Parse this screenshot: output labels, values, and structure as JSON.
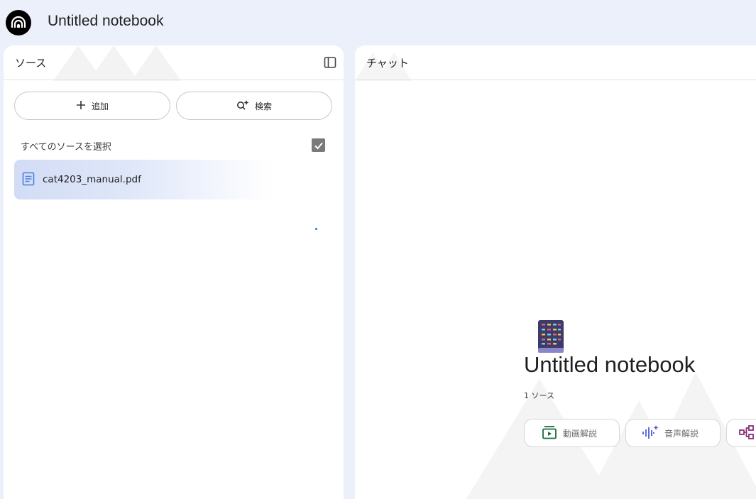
{
  "app": {
    "title": "Untitled notebook",
    "logo_icon": "notebooklm-logo-icon"
  },
  "sources_panel": {
    "title": "ソース",
    "collapse_icon": "panel-collapse-icon",
    "add_button": {
      "label": "追加",
      "icon": "plus-icon"
    },
    "search_button": {
      "label": "検索",
      "icon": "search-sparkle-icon"
    },
    "select_all_label": "すべてのソースを選択",
    "select_all_checked": true,
    "items": [
      {
        "name": "cat4203_manual.pdf",
        "icon": "document-icon",
        "loading": true
      }
    ]
  },
  "chat_panel": {
    "title": "チャット",
    "notebook": {
      "emoji_icon": "notebook-emoji-icon",
      "title": "Untitled notebook",
      "source_count": "1 ソース"
    },
    "studio_buttons": [
      {
        "label": "動画解説",
        "icon": "video-overview-icon",
        "color": "#1e6b3a"
      },
      {
        "label": "音声解説",
        "icon": "audio-overview-icon",
        "color": "#4a5bd6"
      },
      {
        "label": "",
        "icon": "mind-map-icon",
        "color": "#8a2f7a"
      }
    ]
  },
  "colors": {
    "page_bg": "#ecf0fa",
    "panel_bg": "#ffffff",
    "source_highlight": "#d2dcf5",
    "checkbox": "#7a7a7a"
  }
}
